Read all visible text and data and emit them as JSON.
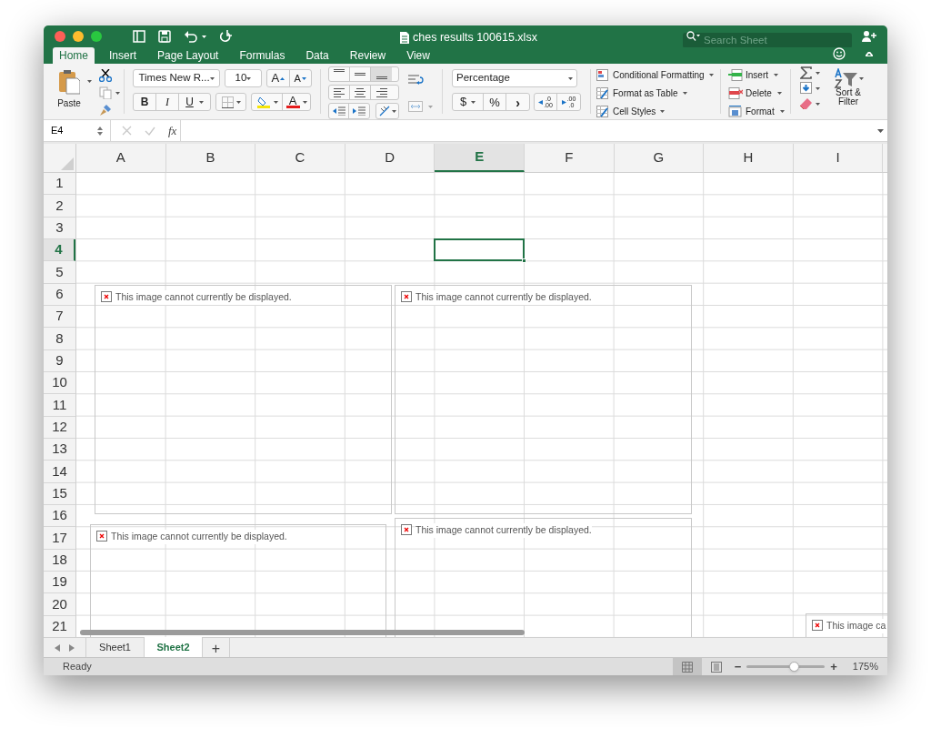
{
  "window": {
    "title": "ches results 100615.xlsx",
    "search": {
      "placeholder": "Search Sheet"
    }
  },
  "tabs": [
    {
      "label": "Home",
      "selected": true
    },
    {
      "label": "Insert",
      "selected": false
    },
    {
      "label": "Page Layout",
      "selected": false
    },
    {
      "label": "Formulas",
      "selected": false
    },
    {
      "label": "Data",
      "selected": false
    },
    {
      "label": "Review",
      "selected": false
    },
    {
      "label": "View",
      "selected": false
    }
  ],
  "ribbon": {
    "paste": "Paste",
    "font": "Times New R...",
    "font_size": "10",
    "grow_font": "A",
    "shrink_font": "A",
    "bold": "B",
    "italic": "I",
    "underline": "U",
    "font_color": "A",
    "number_format": "Percentage",
    "currency": "$",
    "percent": "%",
    "comma": "›",
    "increase_decimal": [
      ".0",
      ".00"
    ],
    "decrease_decimal": [
      ".00",
      ".0"
    ],
    "styles": [
      "Conditional Formatting",
      "Format as Table",
      "Cell Styles"
    ],
    "cells": [
      "Insert",
      "Delete",
      "Format"
    ],
    "sort_filter": "Sort & Filter"
  },
  "formula_bar": {
    "name_box": "E4",
    "fx": "fx"
  },
  "columns": [
    {
      "label": "A",
      "selected": false
    },
    {
      "label": "B",
      "selected": false
    },
    {
      "label": "C",
      "selected": false
    },
    {
      "label": "D",
      "selected": false
    },
    {
      "label": "E",
      "selected": true
    },
    {
      "label": "F",
      "selected": false
    },
    {
      "label": "G",
      "selected": false
    },
    {
      "label": "H",
      "selected": false
    },
    {
      "label": "I",
      "selected": false
    }
  ],
  "rows": [
    {
      "label": "1",
      "selected": false
    },
    {
      "label": "2",
      "selected": false
    },
    {
      "label": "3",
      "selected": false
    },
    {
      "label": "4",
      "selected": true
    },
    {
      "label": "5",
      "selected": false
    },
    {
      "label": "6",
      "selected": false
    },
    {
      "label": "7",
      "selected": false
    },
    {
      "label": "8",
      "selected": false
    },
    {
      "label": "9",
      "selected": false
    },
    {
      "label": "10",
      "selected": false
    },
    {
      "label": "11",
      "selected": false
    },
    {
      "label": "12",
      "selected": false
    },
    {
      "label": "13",
      "selected": false
    },
    {
      "label": "14",
      "selected": false
    },
    {
      "label": "15",
      "selected": false
    },
    {
      "label": "16",
      "selected": false
    },
    {
      "label": "17",
      "selected": false
    },
    {
      "label": "18",
      "selected": false
    },
    {
      "label": "19",
      "selected": false
    },
    {
      "label": "20",
      "selected": false
    },
    {
      "label": "21",
      "selected": false
    }
  ],
  "broken_images": [
    {
      "text": "This image cannot currently be displayed."
    },
    {
      "text": "This image cannot currently be displayed."
    },
    {
      "text": "This image cannot currently be displayed."
    },
    {
      "text": "This image cannot currently be displayed."
    },
    {
      "text": "This image ca"
    }
  ],
  "sheets": [
    {
      "label": "Sheet1",
      "selected": false
    },
    {
      "label": "Sheet2",
      "selected": true
    }
  ],
  "add_sheet": "+",
  "status_bar": {
    "status": "Ready",
    "zoom_out": "−",
    "zoom_in": "+",
    "zoom": {
      "level": 0.61
    },
    "zoom_label": "175%"
  }
}
